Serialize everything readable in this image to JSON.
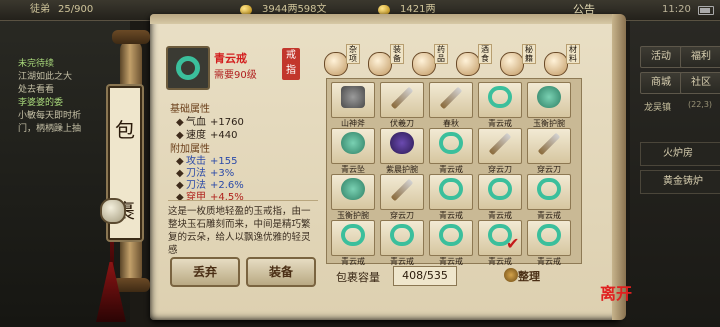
{
  "top_bar": {
    "values": [
      "徒弟",
      "25/900",
      "3944两598文",
      "1421两",
      "公告"
    ],
    "clock": "11:20"
  },
  "quest": {
    "q1_title": "未完待续",
    "q1_lines": [
      "江湖如此之大",
      "处去看看"
    ],
    "q2_title": "李婆婆的委",
    "q2_lines": [
      "小敏每天即时析",
      "门，柄柄躁上抽"
    ]
  },
  "right_panel": {
    "buttons": [
      "活动",
      "福利",
      "商城",
      "社区"
    ],
    "location": "龙吴镇",
    "coords": "(22,3)",
    "entries": [
      "火炉房",
      "黄金铸炉"
    ]
  },
  "scroll": {
    "title_chars": [
      "包",
      "裹"
    ]
  },
  "item": {
    "name": "青云戒",
    "requirement": "需要90级",
    "badge": "戒指",
    "basic_title": "基础属性",
    "basic": [
      {
        "label": "气血",
        "value": "+1760"
      },
      {
        "label": "速度",
        "value": "+440"
      }
    ],
    "extra_title": "附加属性",
    "extra": [
      {
        "label": "攻击",
        "value": "+155"
      },
      {
        "label": "刀法",
        "value": "+3%"
      },
      {
        "label": "刀法",
        "value": "+2.6%"
      },
      {
        "label": "穿甲",
        "value": "+4.5%"
      }
    ],
    "description": "这是一枚质地轻盈的玉戒指，由一整块玉石雕刻而来，中间是精巧繁复的云朵，给人以飘逸优雅的轻灵感"
  },
  "actions": {
    "drop": "丢弃",
    "equip": "装备"
  },
  "tabs": [
    {
      "label": "杂项"
    },
    {
      "label": "装备"
    },
    {
      "label": "药品"
    },
    {
      "label": "酒食"
    },
    {
      "label": "秘籍"
    },
    {
      "label": "材料"
    }
  ],
  "grid": {
    "rows": [
      [
        {
          "type": "axe",
          "name": "山神斧"
        },
        {
          "type": "blade",
          "name": "伏羲刀"
        },
        {
          "type": "blade",
          "name": "春秋"
        },
        {
          "type": "ring",
          "name": "青云戒"
        },
        {
          "type": "jade",
          "name": "玉衡护腕"
        }
      ],
      [
        {
          "type": "jade",
          "name": "青云坠"
        },
        {
          "type": "armor",
          "name": "紫晨护腕"
        },
        {
          "type": "ring",
          "name": "青云戒"
        },
        {
          "type": "blade",
          "name": "穿云刀"
        },
        {
          "type": "blade",
          "name": "穿云刀"
        }
      ],
      [
        {
          "type": "jade",
          "name": "玉衡护腕"
        },
        {
          "type": "blade",
          "name": "穿云刀"
        },
        {
          "type": "ring",
          "name": "青云戒"
        },
        {
          "type": "ring",
          "name": "青云戒"
        },
        {
          "type": "ring",
          "name": "青云戒"
        }
      ],
      [
        {
          "type": "ring",
          "name": "青云戒"
        },
        {
          "type": "ring",
          "name": "青云戒"
        },
        {
          "type": "ring",
          "name": "青云戒"
        },
        {
          "type": "ring",
          "name": "青云戒"
        },
        {
          "type": "ring",
          "name": "青云戒"
        }
      ]
    ]
  },
  "capacity": {
    "label": "包裹容量",
    "value": "408/535"
  },
  "sort_label": "整理",
  "corner_seal": "离开"
}
